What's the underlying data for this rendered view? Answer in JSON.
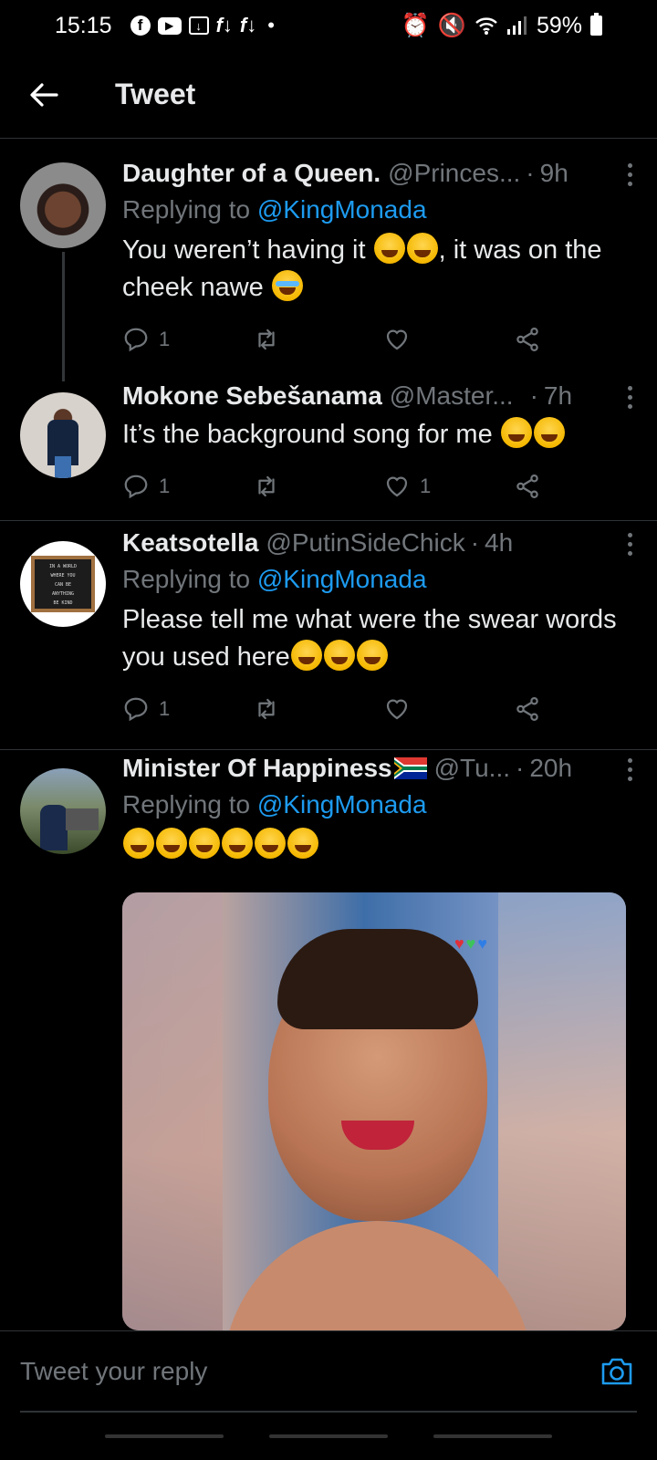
{
  "status_bar": {
    "time": "15:15",
    "battery": "59%"
  },
  "header": {
    "title": "Tweet"
  },
  "tweets": [
    {
      "name": "Daughter of a Queen.",
      "handle": "@Princes...",
      "time": "9h",
      "replying_prefix": "Replying to ",
      "replying_to": "@KingMonada",
      "text_1": "You weren’t having it ",
      "text_2": ", it was on the cheek nawe ",
      "replies": "1",
      "retweets": "",
      "likes": ""
    },
    {
      "name": "Mokone Sebešanama",
      "handle": "@Master...",
      "time": "7h",
      "text_1": "It’s the background song for me ",
      "replies": "1",
      "retweets": "",
      "likes": "1"
    },
    {
      "name": "Keatsotella",
      "handle": "@PutinSideChick",
      "time": "4h",
      "replying_prefix": "Replying to ",
      "replying_to": "@KingMonada",
      "text_1": "Please tell me what were the swear words you used here",
      "replies": "1",
      "retweets": "",
      "likes": ""
    },
    {
      "name": "Minister Of Happiness",
      "handle": "@Tu...",
      "time": "20h",
      "replying_prefix": "Replying to ",
      "replying_to": "@KingMonada"
    }
  ],
  "avatar_3_sign": [
    "IN A WORLD",
    "WHERE YOU",
    "CAN BE",
    "ANYTHING",
    "BE KIND"
  ],
  "reply_bar": {
    "placeholder": "Tweet your reply"
  },
  "colors": {
    "background": "#000000",
    "link": "#1d9bf0",
    "muted": "#71767b",
    "text": "#e7e9ea",
    "divider": "#2f3336"
  },
  "icons": [
    "back-arrow-icon",
    "reply-icon",
    "retweet-icon",
    "like-icon",
    "share-icon",
    "more-icon",
    "camera-icon"
  ]
}
